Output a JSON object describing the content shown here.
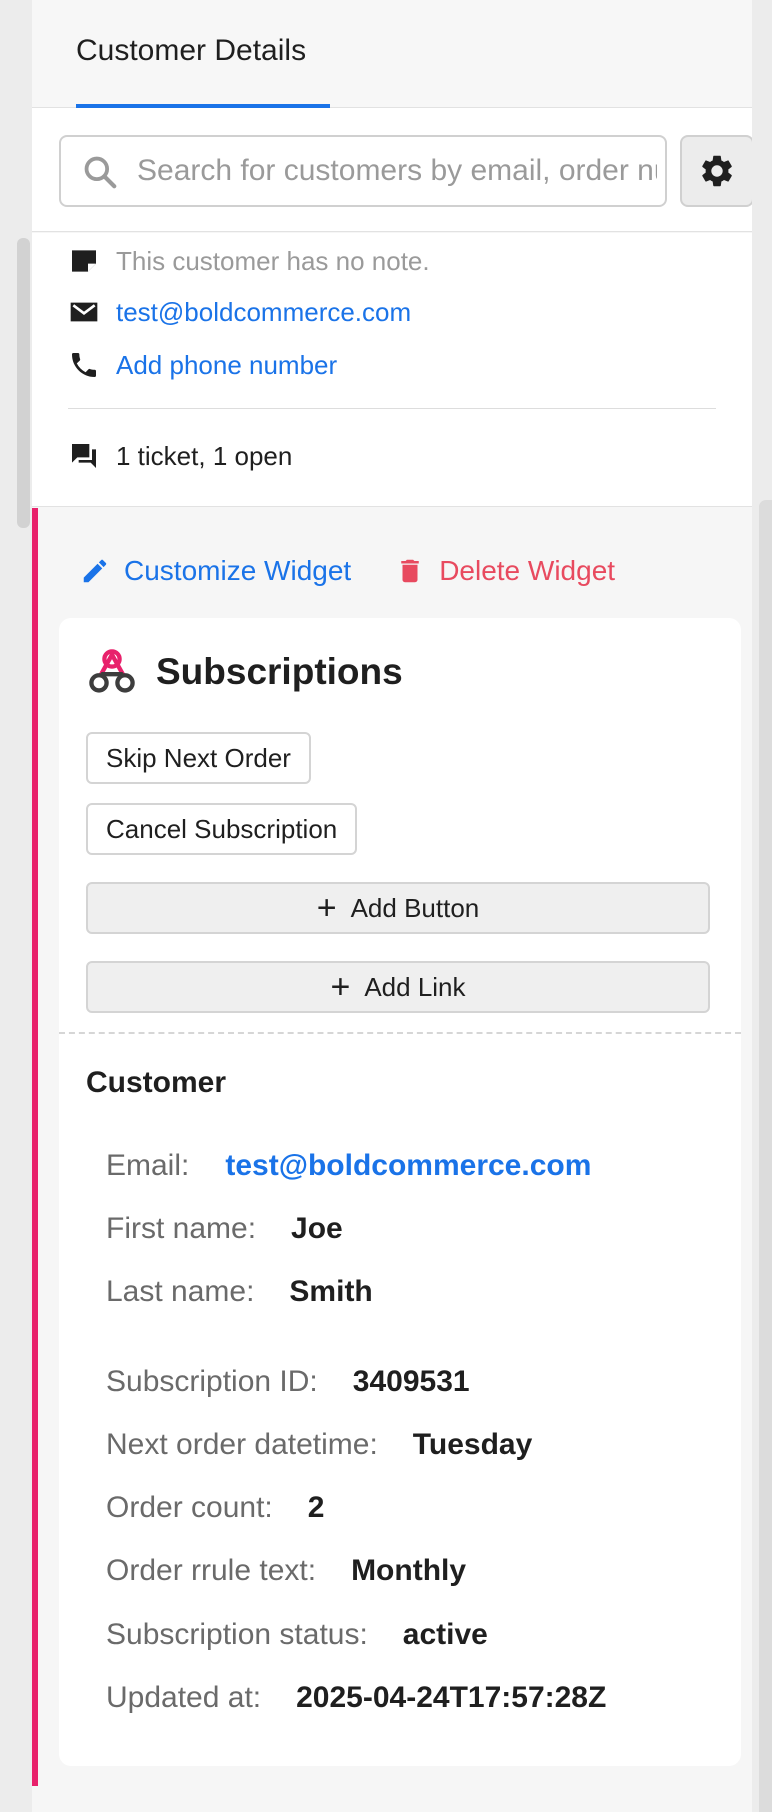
{
  "header": {
    "tab_label": "Customer Details"
  },
  "search": {
    "placeholder": "Search for customers by email, order number, or name",
    "settings_icon": "gear-icon"
  },
  "info": {
    "note": "This customer has no note.",
    "email": "test@boldcommerce.com",
    "phone_link": "Add phone number",
    "tickets": "1 ticket, 1 open"
  },
  "widget": {
    "customize_label": "Customize Widget",
    "delete_label": "Delete Widget",
    "title": "Subscriptions",
    "buttons": [
      "Skip Next Order",
      "Cancel Subscription"
    ],
    "add_button_label": "Add Button",
    "add_link_label": "Add Link",
    "section_title": "Customer",
    "fields": [
      {
        "label": "Email:",
        "value": "test@boldcommerce.com"
      },
      {
        "label": "First name:",
        "value": "Joe"
      },
      {
        "label": "Last name:",
        "value": "Smith"
      },
      {
        "label": "Subscription ID:",
        "value": "3409531"
      },
      {
        "label": "Next order datetime:",
        "value": "Tuesday"
      },
      {
        "label": "Order count:",
        "value": "2"
      },
      {
        "label": "Order rrule text:",
        "value": "Monthly"
      },
      {
        "label": "Subscription status:",
        "value": "active"
      },
      {
        "label": "Updated at:",
        "value": "2025-04-24T17:57:28Z"
      }
    ]
  },
  "colors": {
    "accent": "#e8216b",
    "link": "#1a73e8",
    "danger": "#e84a5f"
  }
}
